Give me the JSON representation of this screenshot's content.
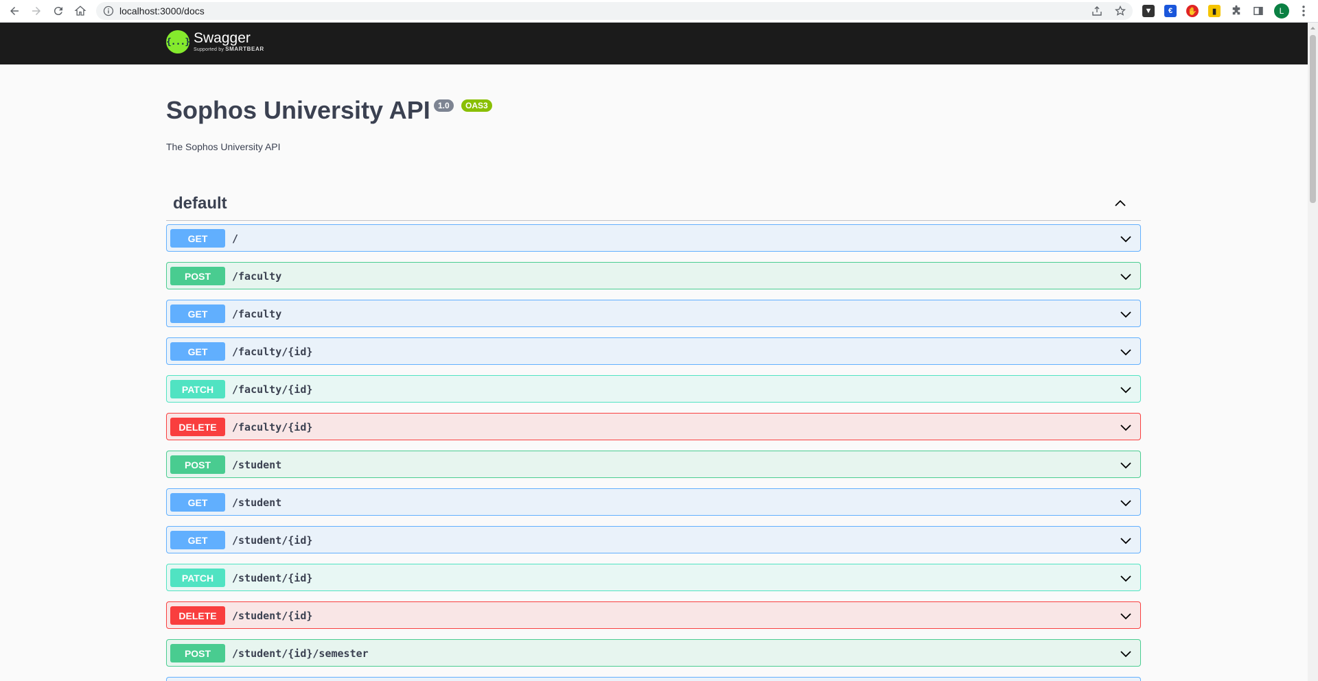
{
  "browser": {
    "url": "localhost:3000/docs",
    "profile_initial": "L"
  },
  "topbar": {
    "logo_symbol": "{...}",
    "logo_name": "Swagger",
    "logo_supported_by": "Supported by",
    "logo_brand": "SMARTBEAR"
  },
  "info": {
    "title": "Sophos University API",
    "version": "1.0",
    "oas": "OAS3",
    "description": "The Sophos University API"
  },
  "tag": {
    "name": "default"
  },
  "operations": [
    {
      "method": "GET",
      "path": "/"
    },
    {
      "method": "POST",
      "path": "/faculty"
    },
    {
      "method": "GET",
      "path": "/faculty"
    },
    {
      "method": "GET",
      "path": "/faculty/{id}"
    },
    {
      "method": "PATCH",
      "path": "/faculty/{id}"
    },
    {
      "method": "DELETE",
      "path": "/faculty/{id}"
    },
    {
      "method": "POST",
      "path": "/student"
    },
    {
      "method": "GET",
      "path": "/student"
    },
    {
      "method": "GET",
      "path": "/student/{id}"
    },
    {
      "method": "PATCH",
      "path": "/student/{id}"
    },
    {
      "method": "DELETE",
      "path": "/student/{id}"
    },
    {
      "method": "POST",
      "path": "/student/{id}/semester"
    }
  ],
  "colors": {
    "get": "#61affe",
    "post": "#49cc90",
    "patch": "#50e3c2",
    "delete": "#f93e3e"
  }
}
